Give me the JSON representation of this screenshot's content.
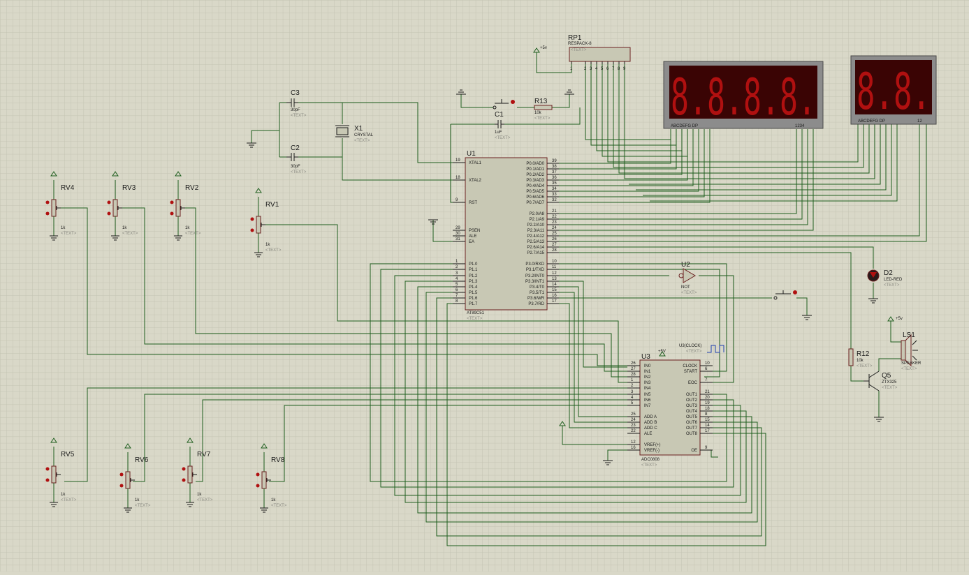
{
  "components": {
    "U1": {
      "ref": "U1",
      "part": "AT89C51",
      "text": "<TEXT>",
      "left_pins": [
        {
          "num": "19",
          "name": "XTAL1"
        },
        {
          "num": "18",
          "name": "XTAL2"
        },
        {
          "num": "9",
          "name": "RST"
        },
        {
          "num": "29",
          "name": "PSEN"
        },
        {
          "num": "30",
          "name": "ALE"
        },
        {
          "num": "31",
          "name": "EA"
        },
        {
          "num": "1",
          "name": "P1.0"
        },
        {
          "num": "2",
          "name": "P1.1"
        },
        {
          "num": "3",
          "name": "P1.2"
        },
        {
          "num": "4",
          "name": "P1.3"
        },
        {
          "num": "5",
          "name": "P1.4"
        },
        {
          "num": "6",
          "name": "P1.5"
        },
        {
          "num": "7",
          "name": "P1.6"
        },
        {
          "num": "8",
          "name": "P1.7"
        }
      ],
      "right_pins": [
        {
          "num": "39",
          "name": "P0.0/AD0"
        },
        {
          "num": "38",
          "name": "P0.1/AD1"
        },
        {
          "num": "37",
          "name": "P0.2/AD2"
        },
        {
          "num": "36",
          "name": "P0.3/AD3"
        },
        {
          "num": "35",
          "name": "P0.4/AD4"
        },
        {
          "num": "34",
          "name": "P0.5/AD5"
        },
        {
          "num": "33",
          "name": "P0.6/AD6"
        },
        {
          "num": "32",
          "name": "P0.7/AD7"
        },
        {
          "num": "21",
          "name": "P2.0/A8"
        },
        {
          "num": "22",
          "name": "P2.1/A9"
        },
        {
          "num": "23",
          "name": "P2.2/A10"
        },
        {
          "num": "24",
          "name": "P2.3/A11"
        },
        {
          "num": "25",
          "name": "P2.4/A12"
        },
        {
          "num": "26",
          "name": "P2.5/A13"
        },
        {
          "num": "27",
          "name": "P2.6/A14"
        },
        {
          "num": "28",
          "name": "P2.7/A15"
        },
        {
          "num": "10",
          "name": "P3.0/RXD"
        },
        {
          "num": "11",
          "name": "P3.1/TXD"
        },
        {
          "num": "12",
          "name": "P3.2/INT0"
        },
        {
          "num": "13",
          "name": "P3.3/INT1"
        },
        {
          "num": "14",
          "name": "P3.4/T0"
        },
        {
          "num": "15",
          "name": "P3.5/T1"
        },
        {
          "num": "16",
          "name": "P3.6/WR"
        },
        {
          "num": "17",
          "name": "P3.7/RD"
        }
      ]
    },
    "U3": {
      "ref": "U3",
      "part": "ADC0808",
      "text": "<TEXT>",
      "supply": "+5V",
      "left_pins": [
        {
          "num": "26",
          "name": "IN0"
        },
        {
          "num": "27",
          "name": "IN1"
        },
        {
          "num": "28",
          "name": "IN2"
        },
        {
          "num": "1",
          "name": "IN3"
        },
        {
          "num": "2",
          "name": "IN4"
        },
        {
          "num": "3",
          "name": "IN5"
        },
        {
          "num": "4",
          "name": "IN6"
        },
        {
          "num": "5",
          "name": "IN7"
        },
        {
          "num": "25",
          "name": "ADD A"
        },
        {
          "num": "24",
          "name": "ADD B"
        },
        {
          "num": "23",
          "name": "ADD C"
        },
        {
          "num": "22",
          "name": "ALE"
        },
        {
          "num": "12",
          "name": "VREF(+)"
        },
        {
          "num": "16",
          "name": "VREF(-)"
        }
      ],
      "right_pins": [
        {
          "num": "10",
          "name": "CLOCK"
        },
        {
          "num": "6",
          "name": "START"
        },
        {
          "num": "7",
          "name": "EOC"
        },
        {
          "num": "21",
          "name": "OUT1"
        },
        {
          "num": "20",
          "name": "OUT2"
        },
        {
          "num": "19",
          "name": "OUT3"
        },
        {
          "num": "18",
          "name": "OUT4"
        },
        {
          "num": "8",
          "name": "OUT5"
        },
        {
          "num": "15",
          "name": "OUT6"
        },
        {
          "num": "14",
          "name": "OUT7"
        },
        {
          "num": "17",
          "name": "OUT8"
        },
        {
          "num": "9",
          "name": "OE"
        }
      ]
    },
    "U2": {
      "ref": "U2",
      "part": "NOT",
      "text": "<TEXT>"
    },
    "U3_clock": {
      "label": "U3(CLOCK)",
      "text": "<TEXT>"
    },
    "RP1": {
      "ref": "RP1",
      "part": "RESPACK-8",
      "text": "<TEXT>",
      "supply": "+5v",
      "pins": [
        "1",
        "2",
        "3",
        "4",
        "5",
        "6",
        "7",
        "8",
        "9"
      ]
    },
    "C1": {
      "ref": "C1",
      "value": "1uF",
      "text": "<TEXT>"
    },
    "C2": {
      "ref": "C2",
      "value": "30pF",
      "text": "<TEXT>"
    },
    "C3": {
      "ref": "C3",
      "value": "30pF",
      "text": "<TEXT>"
    },
    "X1": {
      "ref": "X1",
      "value": "CRYSTAL",
      "text": "<TEXT>"
    },
    "R13": {
      "ref": "R13",
      "value": "10k",
      "text": "<TEXT>"
    },
    "R12": {
      "ref": "R12",
      "value": "10k",
      "text": "<TEXT>"
    },
    "D2": {
      "ref": "D2",
      "value": "LED-RED",
      "text": "<TEXT>"
    },
    "Q5": {
      "ref": "Q5",
      "value": "ZTX325",
      "text": "<TEXT>"
    },
    "LS1": {
      "ref": "LS1",
      "value": "SPEAKER",
      "text": "<TEXT>",
      "supply": "+5v"
    },
    "display4": {
      "digits": "8.8.8.8.",
      "seg_label": "ABCDEFG DP",
      "digit_label": "1234"
    },
    "display2": {
      "digits": "8.8.",
      "seg_label": "ABCDEFG DP",
      "digit_label": "12"
    },
    "pots": [
      {
        "ref": "RV4",
        "value": "1k",
        "text": "<TEXT>"
      },
      {
        "ref": "RV3",
        "value": "1k",
        "text": "<TEXT>"
      },
      {
        "ref": "RV2",
        "value": "1k",
        "text": "<TEXT>"
      },
      {
        "ref": "RV1",
        "value": "1k",
        "text": "<TEXT>"
      },
      {
        "ref": "RV5",
        "value": "1k",
        "text": "<TEXT>"
      },
      {
        "ref": "RV6",
        "value": "1k",
        "text": "<TEXT>"
      },
      {
        "ref": "RV7",
        "value": "1k",
        "text": "<TEXT>"
      },
      {
        "ref": "RV8",
        "value": "1k",
        "text": "<TEXT>"
      }
    ]
  },
  "colors": {
    "background": "#d9d8c8",
    "grid": "#c4c3b2",
    "wire": "#1e5e1e",
    "body": "#c8c8b4",
    "outline": "#6b2020",
    "segment": "#b01010"
  }
}
